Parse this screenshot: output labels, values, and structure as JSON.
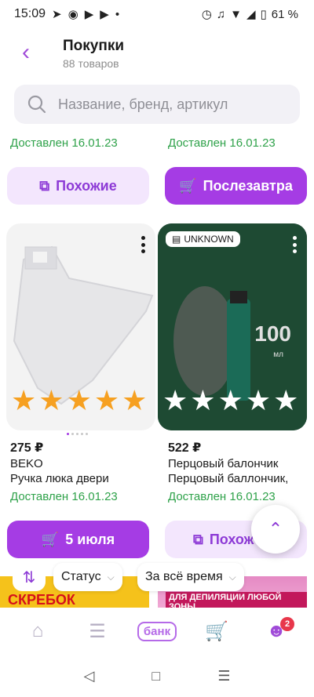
{
  "status_bar": {
    "time": "15:09",
    "battery": "61 %",
    "icons_left": [
      "telegram-icon",
      "location-icon",
      "youtube-icon",
      "youtube-icon",
      "dot-icon"
    ],
    "icons_right": [
      "alarm-icon",
      "headset-icon",
      "wifi-icon",
      "signal-icon",
      "battery-icon"
    ]
  },
  "header": {
    "title": "Покупки",
    "subtitle": "88 товаров"
  },
  "search": {
    "placeholder": "Название, бренд, артикул"
  },
  "top_row": {
    "left_delivered": "Доставлен 16.01.23",
    "right_delivered": "Доставлен 16.01.23",
    "left_button": "Похожие",
    "right_button": "Послезавтра"
  },
  "products": [
    {
      "price": "275 ₽",
      "brand": "BEKO",
      "name": "Ручка люка двери",
      "delivered": "Доставлен 16.01.23",
      "rating": 5,
      "button": "5 июля"
    },
    {
      "price": "522 ₽",
      "brand": "Перцовый балончик",
      "name": "Перцовый баллончик,",
      "delivered": "Доставлен 16.01.23",
      "rating": 0,
      "badge": "UNKNOWN",
      "button": "Похож"
    }
  ],
  "peek": {
    "left_text": "СКРЕБОК",
    "right_text": "ДЛЯ ДЕПИЛЯЦИИ ЛЮБОЙ ЗОНЫ"
  },
  "filters": {
    "status": "Статус",
    "period": "За всё время"
  },
  "tabbar": {
    "bank": "банк",
    "notifications": "2"
  },
  "colors": {
    "accent": "#a53ce4",
    "accent_light": "#f3e6fd",
    "delivered_green": "#2fa24a",
    "star": "#f6a021"
  }
}
